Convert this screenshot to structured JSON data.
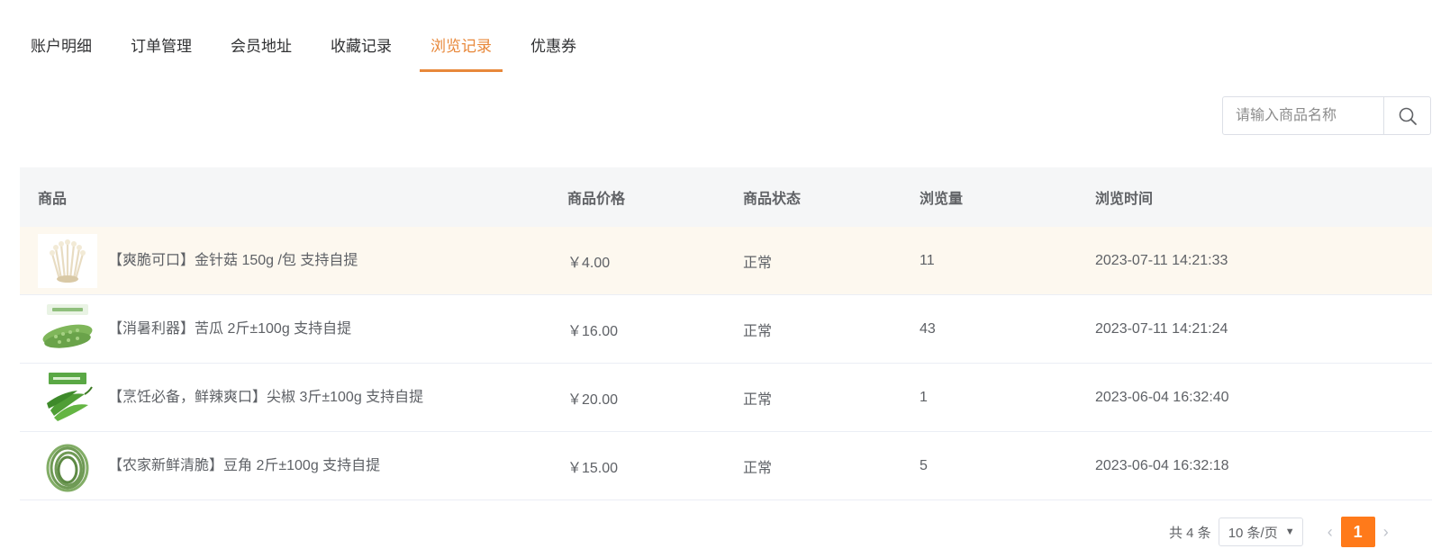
{
  "tabs": [
    {
      "label": "账户明细",
      "active": false
    },
    {
      "label": "订单管理",
      "active": false
    },
    {
      "label": "会员地址",
      "active": false
    },
    {
      "label": "收藏记录",
      "active": false
    },
    {
      "label": "浏览记录",
      "active": true
    },
    {
      "label": "优惠券",
      "active": false
    }
  ],
  "search": {
    "placeholder": "请输入商品名称",
    "icon": "search-icon"
  },
  "table": {
    "headers": [
      "商品",
      "商品价格",
      "商品状态",
      "浏览量",
      "浏览时间"
    ],
    "rows": [
      {
        "name": "【爽脆可口】金针菇 150g /包 支持自提",
        "price": "￥4.00",
        "status": "正常",
        "views": "11",
        "time": "2023-07-11 14:21:33",
        "thumb": "enoki-mushroom-image"
      },
      {
        "name": "【消暑利器】苦瓜 2斤±100g 支持自提",
        "price": "￥16.00",
        "status": "正常",
        "views": "43",
        "time": "2023-07-11 14:21:24",
        "thumb": "bitter-melon-image"
      },
      {
        "name": "【烹饪必备，鲜辣爽口】尖椒 3斤±100g 支持自提",
        "price": "￥20.00",
        "status": "正常",
        "views": "1",
        "time": "2023-06-04 16:32:40",
        "thumb": "green-pepper-image"
      },
      {
        "name": "【农家新鲜清脆】豆角 2斤±100g 支持自提",
        "price": "￥15.00",
        "status": "正常",
        "views": "5",
        "time": "2023-06-04 16:32:18",
        "thumb": "green-bean-image"
      }
    ]
  },
  "pagination": {
    "total": "共 4 条",
    "page_size": "10 条/页",
    "current_page": "1"
  },
  "colors": {
    "accent": "#e8883a",
    "page_active": "#ff7a1a",
    "row_highlight": "#fdf8ef",
    "header_bg": "#f5f6f7"
  }
}
